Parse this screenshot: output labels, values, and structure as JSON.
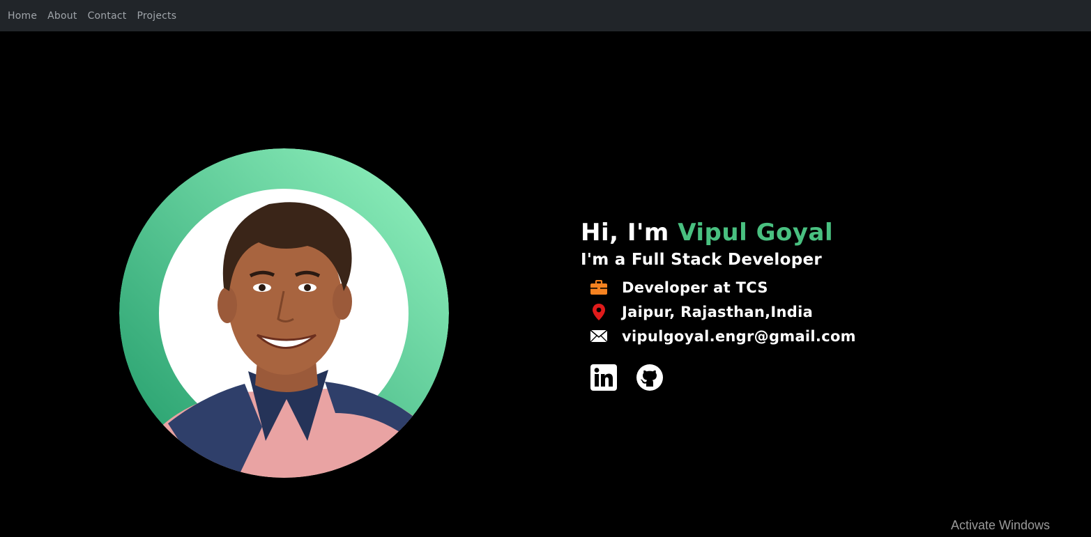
{
  "nav": {
    "links": [
      {
        "label": "Home"
      },
      {
        "label": "About"
      },
      {
        "label": "Contact"
      },
      {
        "label": "Projects"
      }
    ]
  },
  "hero": {
    "greeting_prefix": "Hi, I'm ",
    "name": "Vipul Goyal",
    "role": "I'm a Full Stack Developer",
    "info": [
      {
        "icon": "briefcase-icon",
        "text": "Developer at TCS",
        "color": "#f58220"
      },
      {
        "icon": "location-pin-icon",
        "text": "Jaipur, Rajasthan,India",
        "color": "#e01b1b"
      },
      {
        "icon": "envelope-icon",
        "text": "vipulgoyal.engr@gmail.com",
        "color": "#ffffff"
      }
    ],
    "socials": [
      {
        "icon": "linkedin-icon"
      },
      {
        "icon": "github-icon"
      }
    ],
    "avatar": {
      "icon": "profile-photo"
    }
  },
  "theme": {
    "accent": "#49c080",
    "navbar_bg": "#212529",
    "page_bg": "#000000",
    "ring_gradient_start": "#1f9a68",
    "ring_gradient_end": "#96f5c2"
  },
  "watermark": {
    "text": "Activate Windows"
  }
}
